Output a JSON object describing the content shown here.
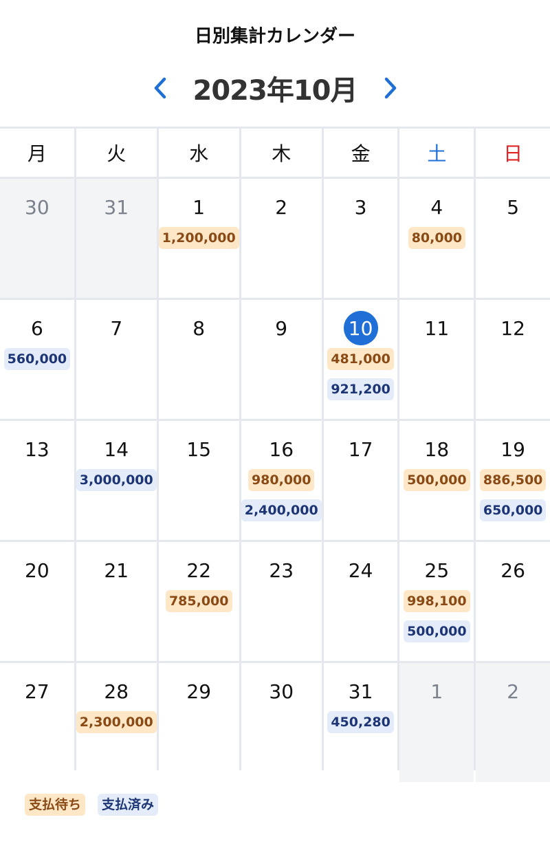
{
  "title": "日別集計カレンダー",
  "month_label": "2023年10月",
  "nav": {
    "prev_icon": "chevron-left-icon",
    "next_icon": "chevron-right-icon"
  },
  "colors": {
    "accent": "#1f6fd6",
    "saturday": "#1f6fd6",
    "sunday": "#e02424",
    "pending_bg": "#fde7c6",
    "pending_text": "#8a4a16",
    "paid_bg": "#e3ecf8",
    "paid_text": "#1d3574"
  },
  "weekdays": [
    "月",
    "火",
    "水",
    "木",
    "金",
    "土",
    "日"
  ],
  "weeks": [
    [
      {
        "day": "30",
        "other": true,
        "pending": "",
        "paid": ""
      },
      {
        "day": "31",
        "other": true,
        "pending": "",
        "paid": ""
      },
      {
        "day": "1",
        "other": false,
        "pending": "1,200,000",
        "paid": ""
      },
      {
        "day": "2",
        "other": false,
        "pending": "",
        "paid": ""
      },
      {
        "day": "3",
        "other": false,
        "pending": "",
        "paid": ""
      },
      {
        "day": "4",
        "other": false,
        "pending": "80,000",
        "paid": ""
      },
      {
        "day": "5",
        "other": false,
        "pending": "",
        "paid": ""
      }
    ],
    [
      {
        "day": "6",
        "other": false,
        "pending": "",
        "paid": "560,000"
      },
      {
        "day": "7",
        "other": false,
        "pending": "",
        "paid": ""
      },
      {
        "day": "8",
        "other": false,
        "pending": "",
        "paid": ""
      },
      {
        "day": "9",
        "other": false,
        "pending": "",
        "paid": ""
      },
      {
        "day": "10",
        "other": false,
        "today": true,
        "pending": "481,000",
        "paid": "921,200"
      },
      {
        "day": "11",
        "other": false,
        "pending": "",
        "paid": ""
      },
      {
        "day": "12",
        "other": false,
        "pending": "",
        "paid": ""
      }
    ],
    [
      {
        "day": "13",
        "other": false,
        "pending": "",
        "paid": ""
      },
      {
        "day": "14",
        "other": false,
        "pending": "",
        "paid": "3,000,000"
      },
      {
        "day": "15",
        "other": false,
        "pending": "",
        "paid": ""
      },
      {
        "day": "16",
        "other": false,
        "pending": "980,000",
        "paid": "2,400,000"
      },
      {
        "day": "17",
        "other": false,
        "pending": "",
        "paid": ""
      },
      {
        "day": "18",
        "other": false,
        "pending": "500,000",
        "paid": ""
      },
      {
        "day": "19",
        "other": false,
        "pending": "886,500",
        "paid": "650,000"
      }
    ],
    [
      {
        "day": "20",
        "other": false,
        "pending": "",
        "paid": ""
      },
      {
        "day": "21",
        "other": false,
        "pending": "",
        "paid": ""
      },
      {
        "day": "22",
        "other": false,
        "pending": "785,000",
        "paid": ""
      },
      {
        "day": "23",
        "other": false,
        "pending": "",
        "paid": ""
      },
      {
        "day": "24",
        "other": false,
        "pending": "",
        "paid": ""
      },
      {
        "day": "25",
        "other": false,
        "pending": "998,100",
        "paid": "500,000"
      },
      {
        "day": "26",
        "other": false,
        "pending": "",
        "paid": ""
      }
    ],
    [
      {
        "day": "27",
        "other": false,
        "pending": "",
        "paid": ""
      },
      {
        "day": "28",
        "other": false,
        "pending": "2,300,000",
        "paid": ""
      },
      {
        "day": "29",
        "other": false,
        "pending": "",
        "paid": ""
      },
      {
        "day": "30",
        "other": false,
        "pending": "",
        "paid": ""
      },
      {
        "day": "31",
        "other": false,
        "pending": "",
        "paid": "450,280"
      },
      {
        "day": "1",
        "other": true,
        "pending": "",
        "paid": ""
      },
      {
        "day": "2",
        "other": true,
        "pending": "",
        "paid": ""
      }
    ]
  ],
  "legend": {
    "pending_label": "支払待ち",
    "paid_label": "支払済み"
  }
}
